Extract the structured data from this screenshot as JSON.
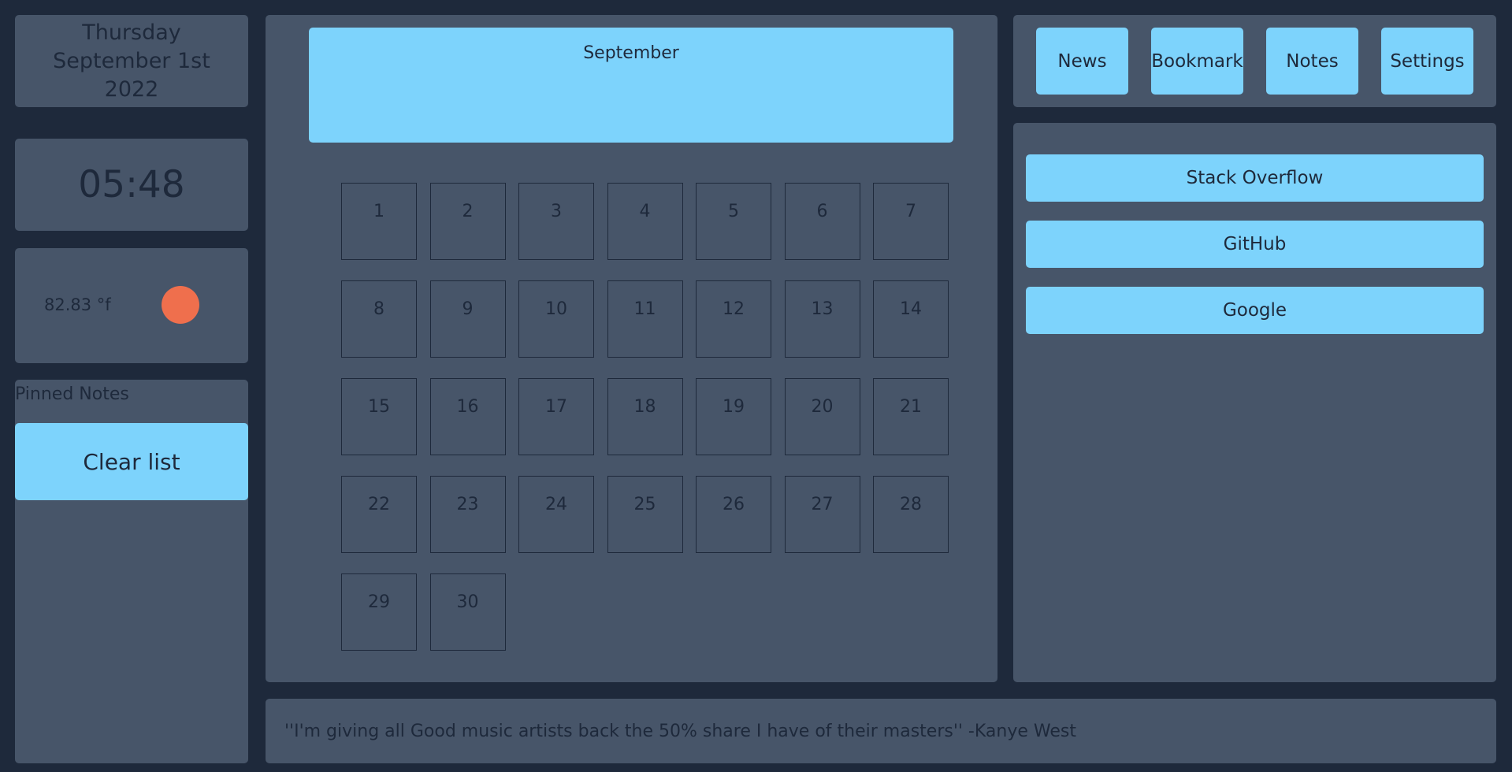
{
  "date": {
    "weekday": "Thursday",
    "month_day": "September 1st",
    "year": "2022"
  },
  "clock": {
    "time": "05:48"
  },
  "weather": {
    "temperature": "82.83 °f",
    "indicator_color": "#ef6f4d"
  },
  "notes": {
    "title": "Pinned Notes",
    "clear_label": "Clear list"
  },
  "calendar": {
    "month": "September",
    "days": [
      "1",
      "2",
      "3",
      "4",
      "5",
      "6",
      "7",
      "8",
      "9",
      "10",
      "11",
      "12",
      "13",
      "14",
      "15",
      "16",
      "17",
      "18",
      "19",
      "20",
      "21",
      "22",
      "23",
      "24",
      "25",
      "26",
      "27",
      "28",
      "29",
      "30"
    ]
  },
  "nav": {
    "items": [
      {
        "label": "News"
      },
      {
        "label": "Bookmark"
      },
      {
        "label": "Notes"
      },
      {
        "label": "Settings"
      }
    ]
  },
  "bookmarks": {
    "items": [
      {
        "label": "Stack Overflow"
      },
      {
        "label": "GitHub"
      },
      {
        "label": "Google"
      }
    ]
  },
  "quote": {
    "text": "''I'm giving all Good music artists back the 50% share I have of their masters'' -Kanye West"
  },
  "colors": {
    "background": "#1e293b",
    "panel": "#475569",
    "accent": "#7dd3fc",
    "weather_indicator": "#ef6f4d"
  }
}
